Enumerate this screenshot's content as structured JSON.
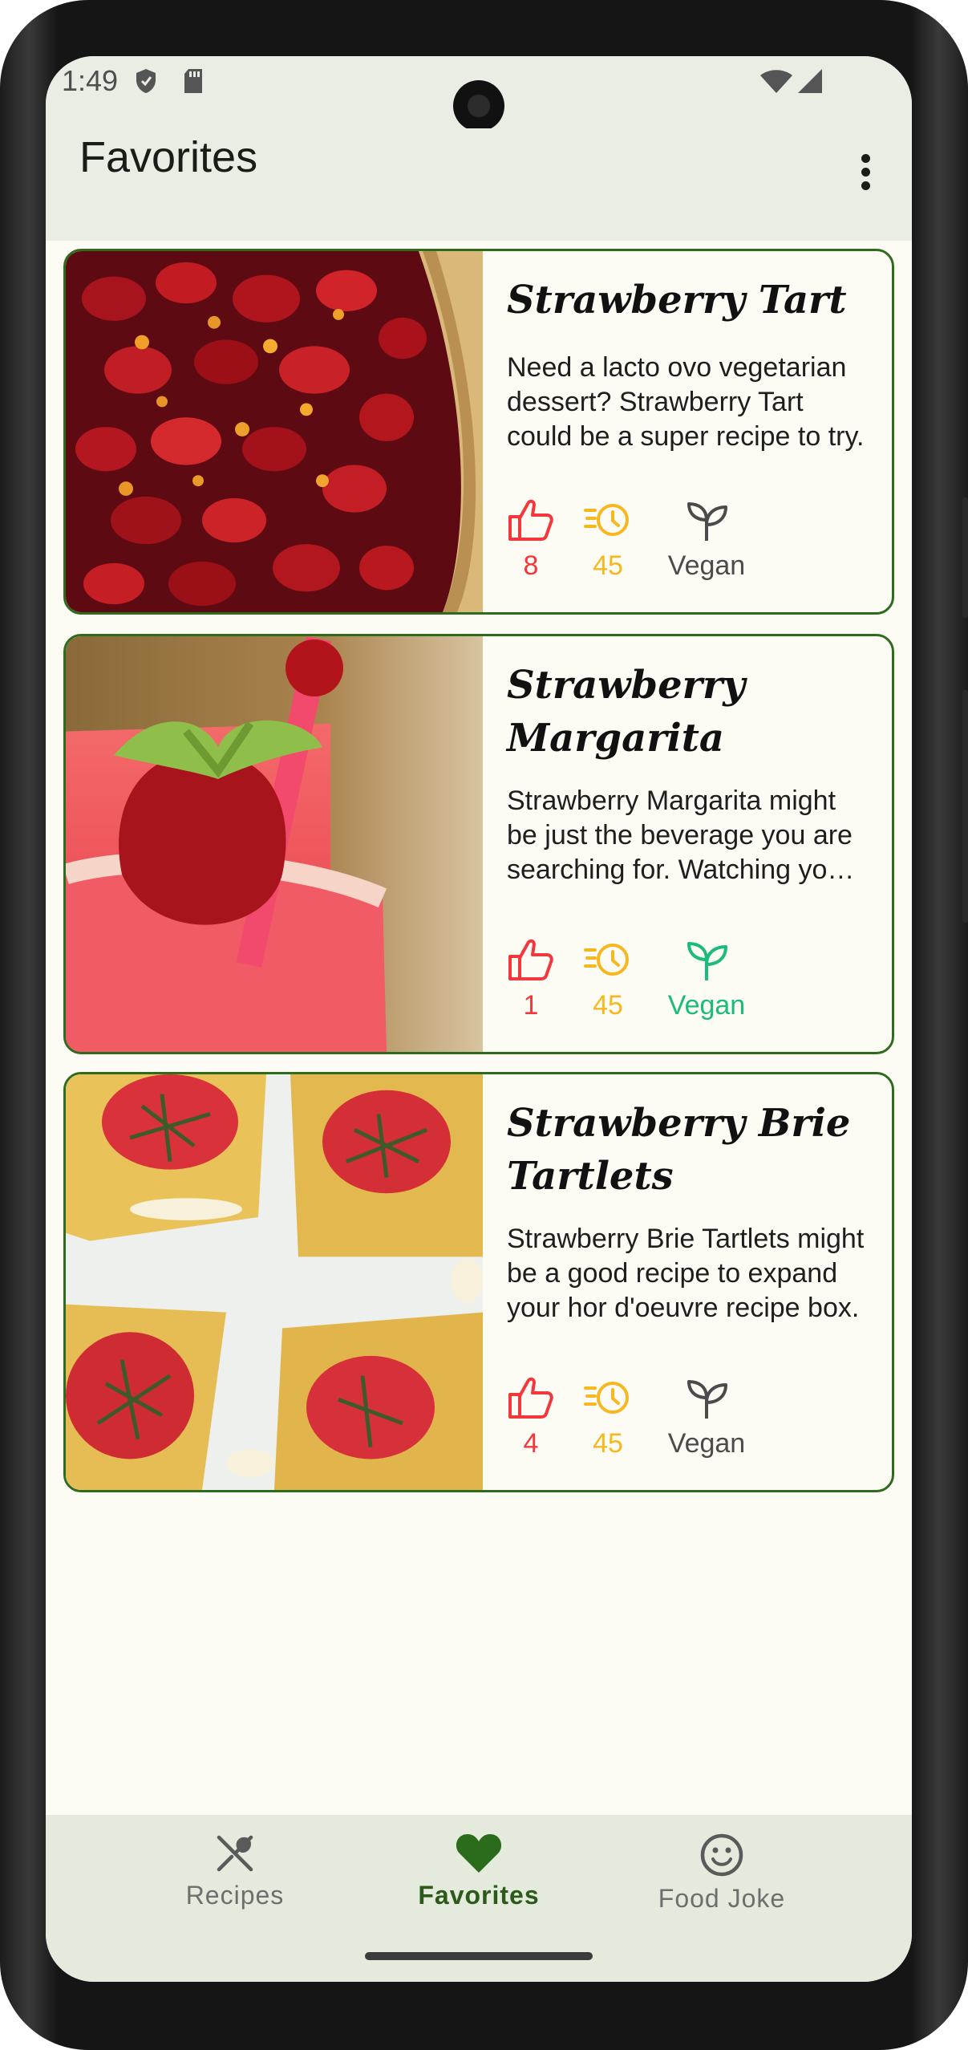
{
  "status_bar": {
    "time": "1:49"
  },
  "app_bar": {
    "title": "Favorites"
  },
  "recipes": [
    {
      "title": "Strawberry Tart",
      "description": "Need a lacto ovo vegetarian dessert? Strawberry Tart could be a super recipe to try.",
      "likes": "8",
      "minutes": "45",
      "vegan_label": "Vegan",
      "vegan": false
    },
    {
      "title": "Strawberry Margarita",
      "description": "Strawberry Margarita might be just the beverage you are searching for. Watching your figure?",
      "likes": "1",
      "minutes": "45",
      "vegan_label": "Vegan",
      "vegan": true
    },
    {
      "title": "Strawberry Brie Tartlets",
      "description": "Strawberry Brie Tartlets might be a good recipe to expand your hor d'oeuvre recipe box.",
      "likes": "4",
      "minutes": "45",
      "vegan_label": "Vegan",
      "vegan": false
    }
  ],
  "bottom_nav": {
    "items": [
      {
        "label": "Recipes",
        "icon": "fork-knife-icon"
      },
      {
        "label": "Favorites",
        "icon": "heart-icon",
        "active": true
      },
      {
        "label": "Food Joke",
        "icon": "smiley-icon"
      }
    ]
  },
  "colors": {
    "accent": "#2e6b1f",
    "like": "#f2383c",
    "time": "#f7b720",
    "vegan_active": "#1dbb7a",
    "vegan_inactive": "#4b4b4b",
    "background": "#fcfcf4",
    "bars": "#e9ede4"
  }
}
